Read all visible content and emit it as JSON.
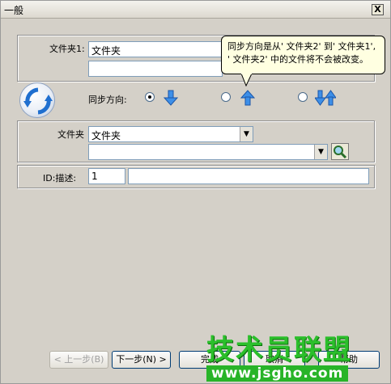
{
  "window": {
    "title": "一般",
    "close_label": "X"
  },
  "folder1": {
    "label": "文件夹1:",
    "value": "文件夹",
    "value2": ""
  },
  "sync": {
    "label": "同步方向:",
    "options": [
      {
        "icon": "arrow-down-icon",
        "selected": true
      },
      {
        "icon": "arrow-up-icon",
        "selected": false
      },
      {
        "icon": "arrow-both-icon",
        "selected": false
      }
    ],
    "accent_color": "#2f7fd8"
  },
  "tooltip": {
    "text_line1": "同步方向是从' 文件夹2' 到' 文件夹1',",
    "text_line2": "' 文件夹2' 中的文件将不会被改变。"
  },
  "folder2": {
    "label": "文件夹",
    "value": "文件夹",
    "value2": ""
  },
  "id_row": {
    "label": "ID:描述:",
    "id_value": "1",
    "desc_value": ""
  },
  "buttons": {
    "back": "< 上一步(B)",
    "next": "下一步(N) >",
    "finish": "完成",
    "cancel": "取消",
    "help": "帮助"
  },
  "watermark": {
    "title": "技术员联盟",
    "url": "www.jsgho.com"
  }
}
